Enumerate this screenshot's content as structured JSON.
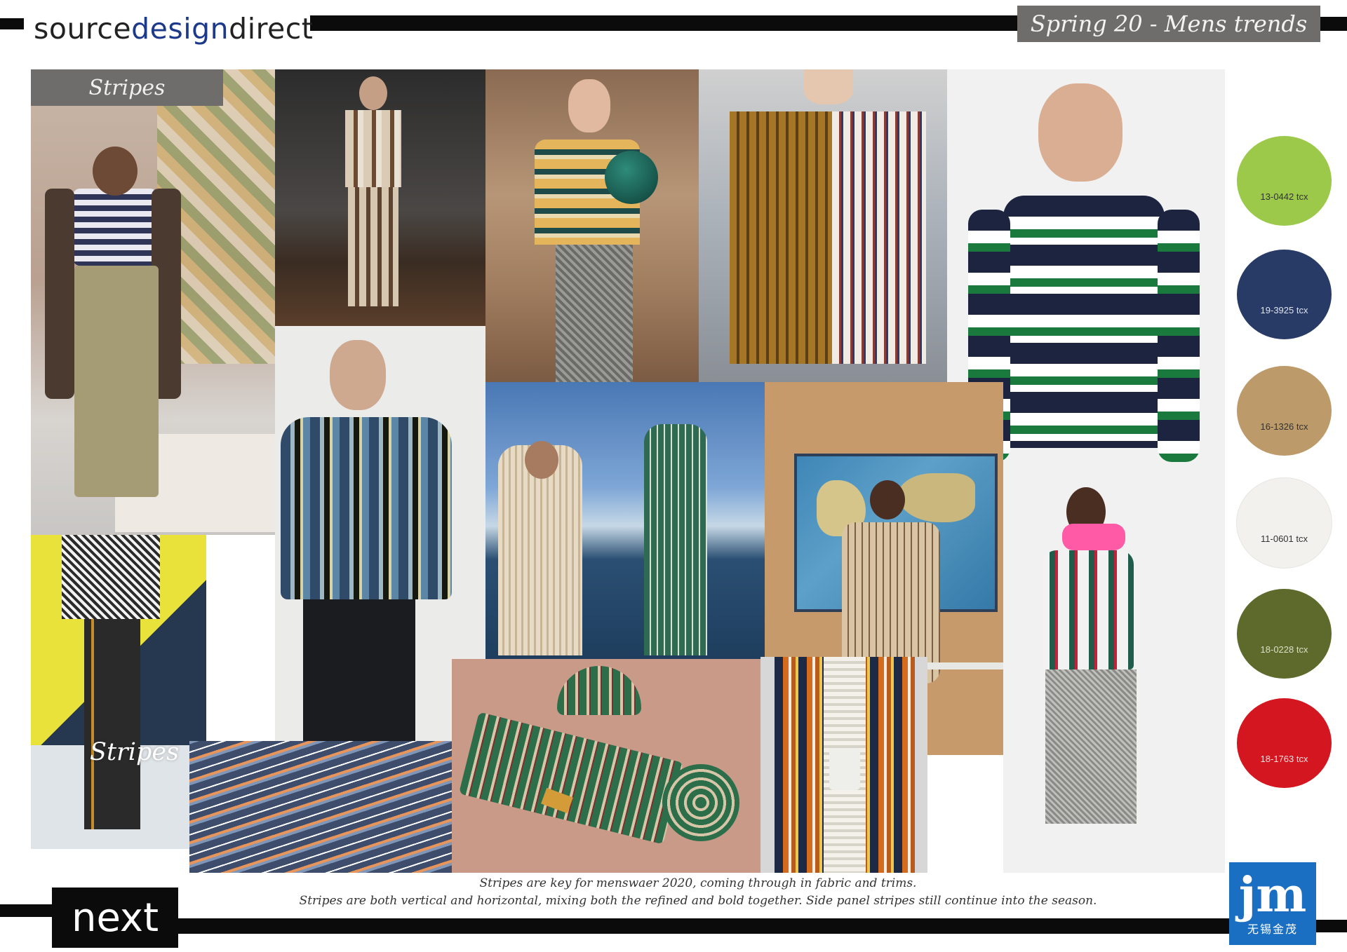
{
  "header": {
    "brand_part1": "source",
    "brand_part2": "design",
    "brand_part3": "direct",
    "season_title": "Spring 20 - Mens trends"
  },
  "board": {
    "label_top": "Stripes",
    "label_overlay": "Stripes"
  },
  "swatches": [
    {
      "code": "13-0442 tcx",
      "color": "#9cc94a"
    },
    {
      "code": "19-3925 tcx",
      "color": "#283a66"
    },
    {
      "code": "16-1326 tcx",
      "color": "#bd9a6a"
    },
    {
      "code": "11-0601 tcx",
      "color": "#f2f1ee"
    },
    {
      "code": "18-0228 tcx",
      "color": "#5e6a2c"
    },
    {
      "code": "18-1763 tcx",
      "color": "#d3161f"
    }
  ],
  "caption": {
    "line1": "Stripes are key for menswaer 2020, coming through in fabric and trims.",
    "line2": "Stripes are both vertical and horizontal, mixing both the refined and bold together.  Side panel stripes still continue into the season."
  },
  "footer": {
    "left_logo": "next",
    "right_logo_letters": "jm",
    "right_logo_text": "无锡金茂"
  }
}
